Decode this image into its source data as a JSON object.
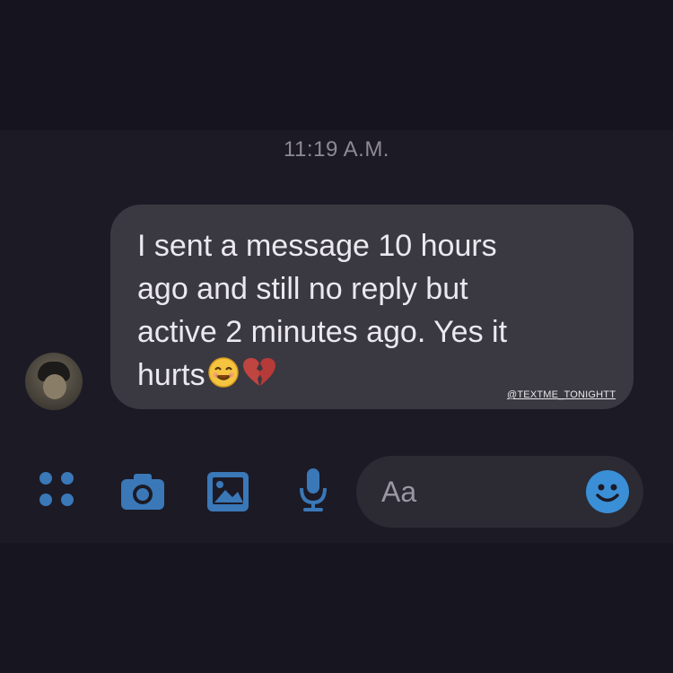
{
  "header": {
    "timestamp": "11:19 A.M."
  },
  "message": {
    "text": "I sent a message 10 hours\nago and still no reply but\nactive 2 minutes ago. Yes it\nhurts",
    "emojis": [
      "smiling-face-icon",
      "broken-heart-icon"
    ],
    "watermark": "@TEXTME_TONIGHTT"
  },
  "composer": {
    "placeholder": "Aa",
    "actions": [
      "apps-grid-icon",
      "camera-icon",
      "gallery-icon",
      "microphone-icon",
      "smiley-emoji-icon"
    ]
  },
  "colors": {
    "accent": "#3a78b8",
    "bubble": "#3a3840",
    "background": "#1c1a25",
    "text": "#ebe9ef"
  }
}
